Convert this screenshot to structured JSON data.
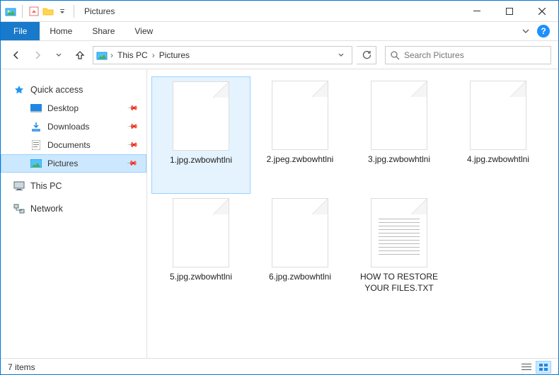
{
  "titlebar": {
    "title": "Pictures"
  },
  "ribbon": {
    "file": "File",
    "tabs": [
      "Home",
      "Share",
      "View"
    ]
  },
  "breadcrumb": {
    "items": [
      "This PC",
      "Pictures"
    ]
  },
  "search": {
    "placeholder": "Search Pictures"
  },
  "sidebar": {
    "quick_access": "Quick access",
    "quick_items": [
      {
        "label": "Desktop",
        "icon": "desktop"
      },
      {
        "label": "Downloads",
        "icon": "downloads"
      },
      {
        "label": "Documents",
        "icon": "documents"
      },
      {
        "label": "Pictures",
        "icon": "pictures",
        "selected": true
      }
    ],
    "this_pc": "This PC",
    "network": "Network"
  },
  "files": [
    {
      "name": "1.jpg.zwbowhtlni",
      "type": "blank",
      "selected": true
    },
    {
      "name": "2.jpeg.zwbowhtlni",
      "type": "blank"
    },
    {
      "name": "3.jpg.zwbowhtlni",
      "type": "blank"
    },
    {
      "name": "4.jpg.zwbowhtlni",
      "type": "blank"
    },
    {
      "name": "5.jpg.zwbowhtlni",
      "type": "blank"
    },
    {
      "name": "6.jpg.zwbowhtlni",
      "type": "blank"
    },
    {
      "name": "HOW TO RESTORE YOUR FILES.TXT",
      "type": "txt"
    }
  ],
  "statusbar": {
    "count": "7 items"
  },
  "colors": {
    "accent": "#0078d7",
    "selection": "#cce8ff"
  }
}
